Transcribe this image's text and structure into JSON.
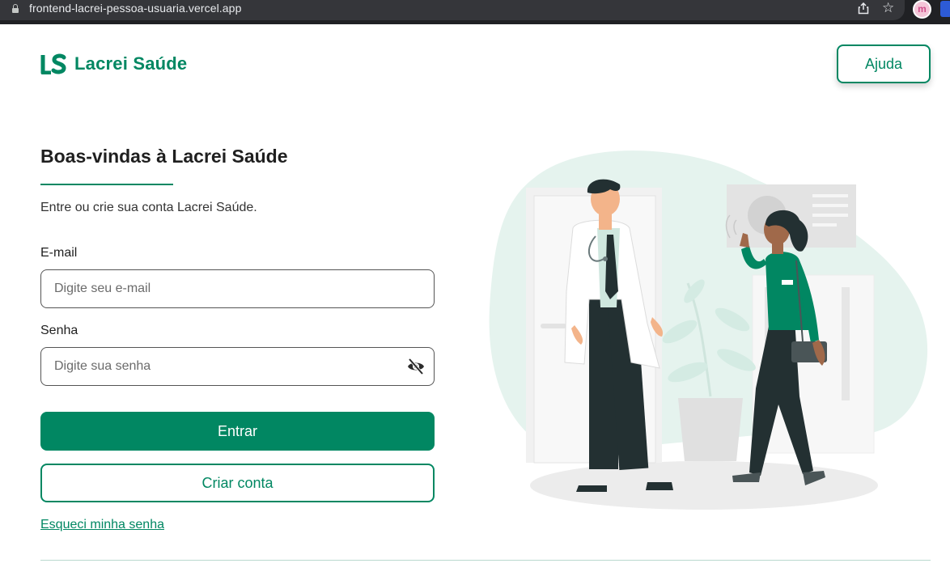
{
  "browser": {
    "url": "frontend-lacrei-pessoa-usuaria.vercel.app",
    "profile_initial": "m"
  },
  "header": {
    "brand_name": "Lacrei Saúde",
    "help_label": "Ajuda"
  },
  "login": {
    "title": "Boas-vindas à Lacrei Saúde",
    "subtitle": "Entre ou crie sua conta Lacrei Saúde.",
    "email_label": "E-mail",
    "email_placeholder": "Digite seu e-mail",
    "password_label": "Senha",
    "password_placeholder": "Digite sua senha",
    "submit_label": "Entrar",
    "create_label": "Criar conta",
    "forgot_label": "Esqueci minha senha"
  },
  "icons": {
    "lock": "lock-icon",
    "share": "share-icon",
    "star": "star-icon",
    "visibility_off": "eye-off-icon"
  },
  "colors": {
    "brand": "#018762",
    "text": "#1f1f1f",
    "chrome": "#202124"
  }
}
